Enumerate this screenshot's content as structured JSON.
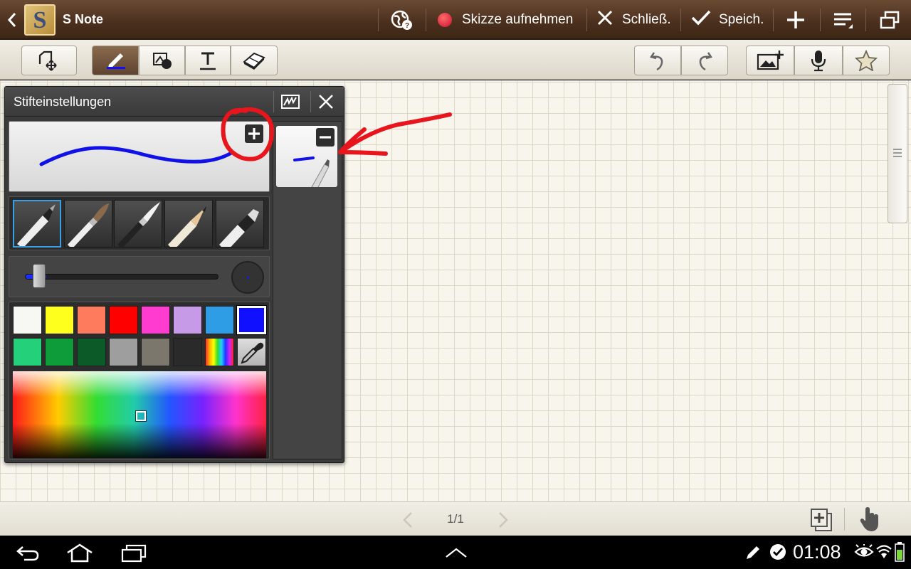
{
  "app": {
    "title": "S Note",
    "logo_letter": "S"
  },
  "actionbar": {
    "record_label": "Skizze aufnehmen",
    "close_label": "Schließ.",
    "save_label": "Speich."
  },
  "pen_panel": {
    "title": "Stifteinstellungen",
    "selected_pen_index": 0,
    "pen_size_fraction": 0.07,
    "stroke_color": "#1010e8",
    "swatches_row1": [
      "#f7f7f3",
      "#ffff1e",
      "#ff7b5e",
      "#ff0000",
      "#ff3ccf",
      "#c79ae8",
      "#2f9ce6",
      "#1010ff"
    ],
    "swatches_row2": [
      "#24d07a",
      "#0e9c3a",
      "#0c5a28",
      "#9e9e9e",
      "#7b776d",
      "#2a2a2a",
      "rainbow",
      "eyedropper-icon"
    ],
    "selected_swatch": "#1010ff"
  },
  "pagebar": {
    "page_indicator": "1/1"
  },
  "statusbar": {
    "time": "01:08"
  },
  "annotation": {
    "color": "#e8151d"
  }
}
